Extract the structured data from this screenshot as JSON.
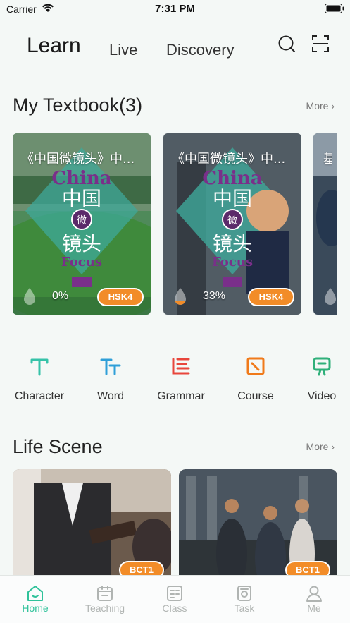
{
  "status_bar": {
    "carrier": "Carrier",
    "time": "7:31 PM"
  },
  "top_nav": {
    "tabs": [
      {
        "label": "Learn",
        "active": true
      },
      {
        "label": "Live",
        "active": false
      },
      {
        "label": "Discovery",
        "active": false
      }
    ],
    "icons": [
      "search-icon",
      "scan-icon"
    ]
  },
  "textbook": {
    "title": "My Textbook(3)",
    "more": "More ›",
    "cards": [
      {
        "title": "《中国微镜头》中...",
        "progress": "0%",
        "level": "HSK4"
      },
      {
        "title": "《中国微镜头》中...",
        "progress": "33%",
        "level": "HSK4"
      },
      {
        "title": "基",
        "progress": "",
        "level": ""
      }
    ]
  },
  "features": [
    {
      "label": "Character",
      "icon": "character-icon",
      "color": "#35c2a8"
    },
    {
      "label": "Word",
      "icon": "word-icon",
      "color": "#2f9fd8"
    },
    {
      "label": "Grammar",
      "icon": "grammar-icon",
      "color": "#e8463c"
    },
    {
      "label": "Course",
      "icon": "course-icon",
      "color": "#f07a1a"
    },
    {
      "label": "Video",
      "icon": "video-icon",
      "color": "#2fb07a"
    }
  ],
  "life_scene": {
    "title": "Life Scene",
    "more": "More ›",
    "cards": [
      {
        "level": "BCT1"
      },
      {
        "level": "BCT1"
      }
    ]
  },
  "tab_bar": {
    "items": [
      {
        "label": "Home",
        "icon": "home-icon",
        "active": true
      },
      {
        "label": "Teaching",
        "icon": "teaching-icon",
        "active": false
      },
      {
        "label": "Class",
        "icon": "class-icon",
        "active": false
      },
      {
        "label": "Task",
        "icon": "task-icon",
        "active": false
      },
      {
        "label": "Me",
        "icon": "me-icon",
        "active": false
      }
    ]
  },
  "colors": {
    "accent": "#2fc29a",
    "badge": "#f28c28",
    "card_teal": "#3fa89a"
  }
}
